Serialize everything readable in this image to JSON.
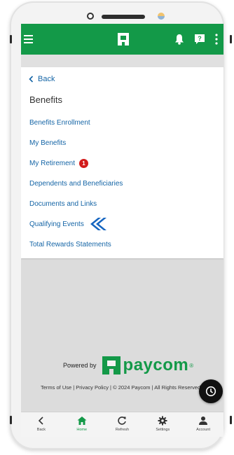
{
  "header": {
    "logo_icon": "paycom-logo-icon",
    "menu_icon": "hamburger-icon",
    "bell_icon": "bell-icon",
    "help_icon": "help-icon",
    "more_icon": "kebab-icon"
  },
  "back_label": "Back",
  "section_title": "Benefits",
  "menu_items": [
    {
      "label": "Benefits Enrollment"
    },
    {
      "label": "My Benefits"
    },
    {
      "label": "My Retirement",
      "badge": "1"
    },
    {
      "label": "Dependents and Beneficiaries"
    },
    {
      "label": "Documents and Links"
    },
    {
      "label": "Qualifying Events"
    },
    {
      "label": "Total Rewards Statements"
    }
  ],
  "footer": {
    "powered_by": "Powered by",
    "brand": "paycom",
    "brand_reg": "®",
    "links": "Terms of Use | Privacy Policy | © 2024 Paycom | All Rights Reserved"
  },
  "bottom_nav": [
    {
      "label": "Back",
      "icon": "chevron-left-icon"
    },
    {
      "label": "Home",
      "icon": "home-icon",
      "active": true
    },
    {
      "label": "Refresh",
      "icon": "refresh-icon"
    },
    {
      "label": "Settings",
      "icon": "gear-icon"
    },
    {
      "label": "Account",
      "icon": "person-icon"
    }
  ],
  "colors": {
    "brand_green": "#139948",
    "link_blue": "#1565a6",
    "badge_red": "#d21b1b"
  }
}
